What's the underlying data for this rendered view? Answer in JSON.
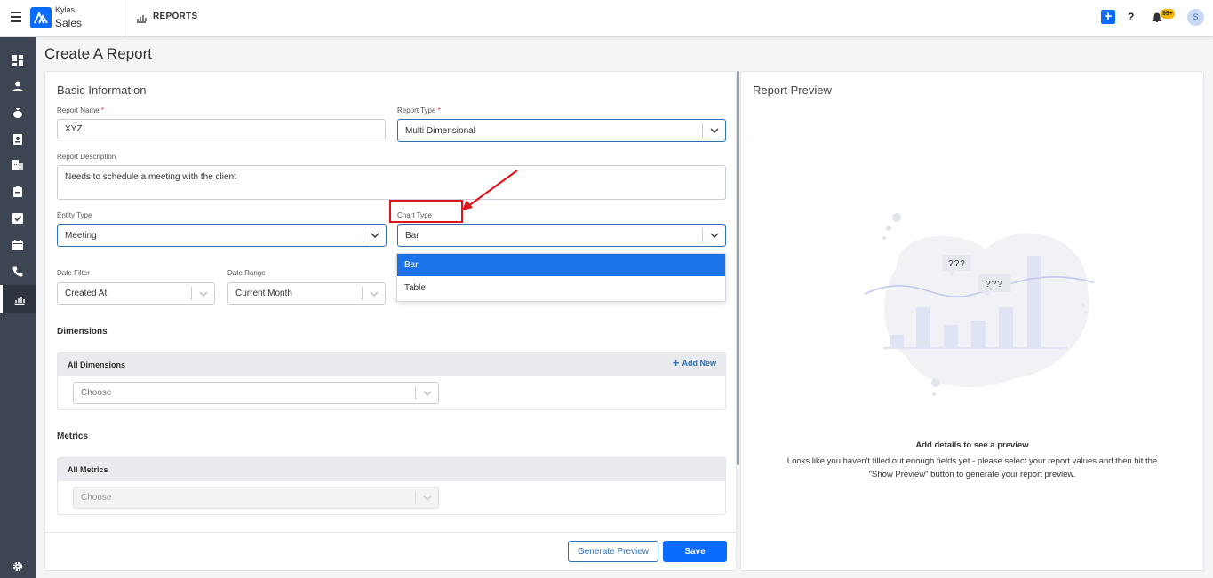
{
  "header": {
    "brand_small": "Kylas",
    "brand_app": "Sales",
    "section": "REPORTS",
    "notifications_count": "99+",
    "avatar_initial": "S"
  },
  "page": {
    "title": "Create A Report"
  },
  "form": {
    "section_title": "Basic Information",
    "report_name": {
      "label": "Report Name",
      "required_mark": "*",
      "value": "XYZ"
    },
    "report_type": {
      "label": "Report Type",
      "required_mark": "*",
      "value": "Multi Dimensional"
    },
    "report_description": {
      "label": "Report Description",
      "value": "Needs to schedule a meeting with the client"
    },
    "entity_type": {
      "label": "Entity Type",
      "value": "Meeting"
    },
    "chart_type": {
      "label": "Chart Type",
      "value": "Bar",
      "options": [
        "Bar",
        "Table"
      ],
      "highlighted_option": "Bar"
    },
    "date_filter": {
      "label": "Date Filter",
      "value": "Created At"
    },
    "date_range": {
      "label": "Date Range",
      "value": "Current Month"
    },
    "dimensions": {
      "title": "Dimensions",
      "box_title": "All Dimensions",
      "add_label": "Add New",
      "placeholder": "Choose"
    },
    "metrics": {
      "title": "Metrics",
      "box_title": "All Metrics",
      "placeholder": "Choose"
    },
    "buttons": {
      "preview": "Generate Preview",
      "save": "Save"
    }
  },
  "preview": {
    "title": "Report Preview",
    "bubble_1": "???",
    "bubble_2": "???",
    "empty_heading": "Add details to see a preview",
    "empty_line_1": "Looks like you haven't filled out enough fields yet - please select your report values and then hit the",
    "empty_line_2": "\"Show Preview\" button to generate your report preview."
  },
  "colors": {
    "primary": "#0a6cff",
    "sidebar": "#3d4452",
    "highlight_option": "#1a73e8",
    "annotation": "#e0151b"
  },
  "icons": [
    "menu-icon",
    "logo-icon",
    "reports-icon",
    "plus-icon",
    "help-icon",
    "bell-icon",
    "dashboard-icon",
    "contacts-icon",
    "deals-icon",
    "leads-icon",
    "companies-icon",
    "products-icon",
    "tasks-icon",
    "calendar-icon",
    "calls-icon",
    "reports-nav-icon",
    "settings-icon",
    "chevron-down-icon"
  ]
}
